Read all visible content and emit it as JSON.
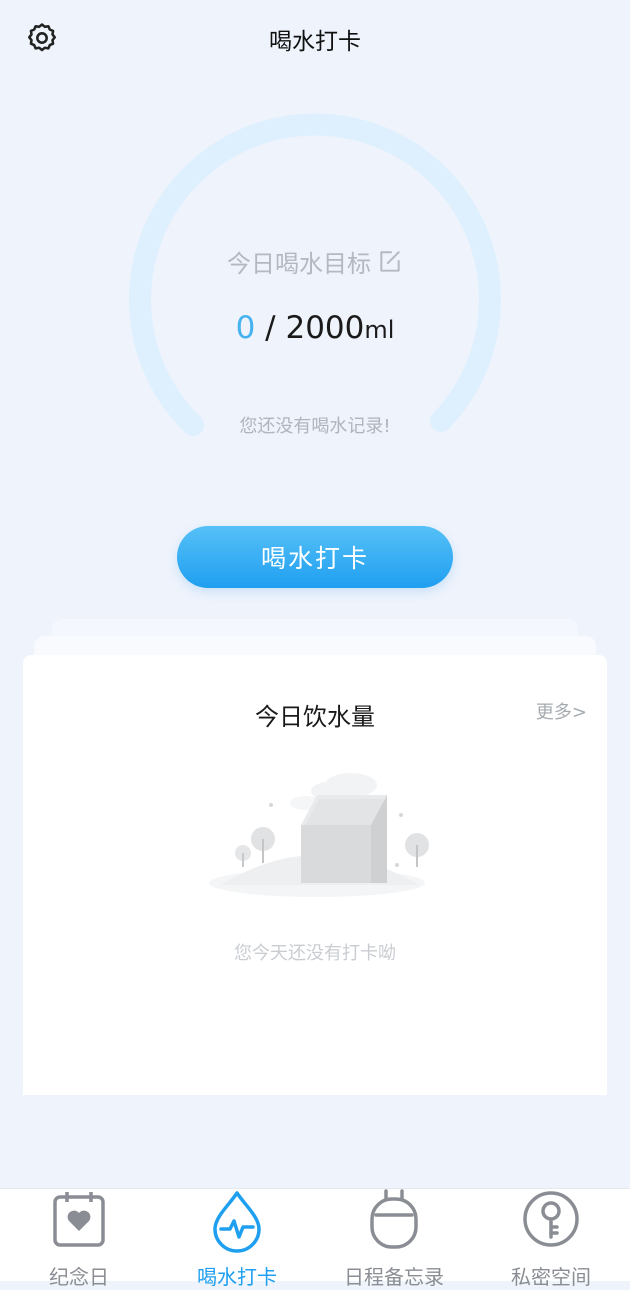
{
  "header": {
    "title": "喝水打卡",
    "settings_icon": "gear-icon"
  },
  "goal": {
    "label": "今日喝水目标",
    "current": "0",
    "separator": " / ",
    "target": "2000",
    "unit": "ml",
    "progress_fraction": 0,
    "status_text": "您还没有喝水记录!",
    "edit_icon": "edit-icon"
  },
  "checkin": {
    "button_label": "喝水打卡"
  },
  "today_card": {
    "title": "今日饮水量",
    "more_label": "更多>",
    "empty_text": "您今天还没有打卡呦",
    "illustration": "empty-box-illustration"
  },
  "tabbar": {
    "items": [
      {
        "label": "纪念日",
        "icon": "calendar-heart-icon",
        "active": false
      },
      {
        "label": "喝水打卡",
        "icon": "water-drop-pulse-icon",
        "active": true
      },
      {
        "label": "日程备忘录",
        "icon": "alarm-clock-icon",
        "active": false
      },
      {
        "label": "私密空间",
        "icon": "key-icon",
        "active": false
      }
    ]
  },
  "colors": {
    "accent": "#1f9ff0",
    "ring": "#def0fe",
    "background": "#eef3fc"
  }
}
